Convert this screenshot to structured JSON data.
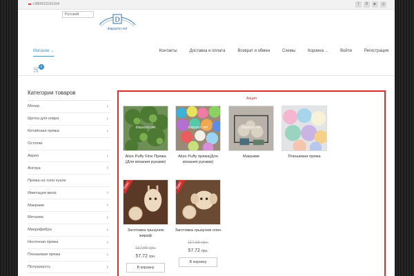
{
  "topbar": {
    "phone": "+380631161164",
    "social": [
      {
        "icon": "facebook-icon",
        "glyph": "f"
      },
      {
        "icon": "vk-icon",
        "glyph": "B"
      },
      {
        "icon": "youtube-icon",
        "glyph": "▶"
      },
      {
        "icon": "instagram-icon",
        "glyph": "◎"
      }
    ]
  },
  "header": {
    "language": "Русский",
    "logo_letter": "D",
    "logo_text": "diapazon.net"
  },
  "nav": {
    "shop": "Магазин",
    "items": [
      {
        "label": "Контакты",
        "dropdown": false
      },
      {
        "label": "Доставка и оплата",
        "dropdown": false
      },
      {
        "label": "Возврат и обмен",
        "dropdown": false
      },
      {
        "label": "Схемы",
        "dropdown": false
      },
      {
        "label": "Корзина",
        "dropdown": true
      },
      {
        "label": "Войти",
        "dropdown": false
      },
      {
        "label": "Регистрация",
        "dropdown": false
      }
    ],
    "cart_count": "0"
  },
  "sidebar": {
    "title": "Категории товаров",
    "categories": [
      {
        "label": "Мохер",
        "arrow": true
      },
      {
        "label": "Щетка для ковра",
        "arrow": true
      },
      {
        "label": "Китайская пряжа",
        "arrow": true
      },
      {
        "label": "Остатки",
        "arrow": false
      },
      {
        "label": "Акрил",
        "arrow": true
      },
      {
        "label": "Ангора",
        "arrow": true
      },
      {
        "label": "Пряжа на топо кукле",
        "arrow": false
      },
      {
        "label": "Имитация меха",
        "arrow": true
      },
      {
        "label": "Макраме",
        "arrow": true
      },
      {
        "label": "Металик",
        "arrow": true
      },
      {
        "label": "Микрофибра",
        "arrow": true
      },
      {
        "label": "Носочная пряжа",
        "arrow": true
      },
      {
        "label": "Плюшевая пряжа",
        "arrow": true
      },
      {
        "label": "Полушерсть",
        "arrow": true
      }
    ]
  },
  "promo": {
    "title": "Акция",
    "products": [
      {
        "name": "Alize Puffy Fine Пряжа (Для вязания руками)",
        "image": "green-yarn",
        "watermark": "diapazon.net"
      },
      {
        "name": "Alize Puffy пряжа(Для вязания руками)",
        "image": "colorful-yarn",
        "watermark": "diapazon.net"
      },
      {
        "name": "Макраме",
        "image": "macrame-basket",
        "watermark": "diapazon.net"
      },
      {
        "name": "Плюшевая пряжа",
        "image": "plush-yarn-balls"
      },
      {
        "name": "Заготовка грызунов жираф",
        "image": "giraffe-teether",
        "sale": "Sale!",
        "old_price": "117.66 грн.",
        "price": "57.72",
        "currency": "грн.",
        "button": "В корзину"
      },
      {
        "name": "Заготовка грызунов слон",
        "image": "elephant-teether",
        "sale": "Sale!",
        "old_price": "117.66 грн.",
        "price": "57.72",
        "currency": "грн.",
        "button": "В корзину"
      }
    ]
  },
  "colors": {
    "accent": "#3b8fc9",
    "sale": "#d62d2d"
  }
}
